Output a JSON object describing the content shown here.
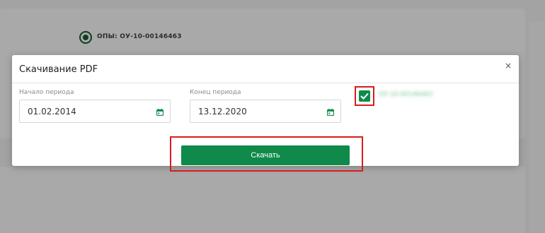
{
  "background": {
    "radio_label": "ОПЫ: ОУ-10-00146463"
  },
  "modal": {
    "title": "Скачивание PDF",
    "close_symbol": "×",
    "start": {
      "label": "Начало периода",
      "value": "01.02.2014",
      "icon": "calendar-icon"
    },
    "end": {
      "label": "Конец периода",
      "value": "13.12.2020",
      "icon": "calendar-icon"
    },
    "checkbox": {
      "checked": true,
      "label": "ОУ-10-00146463"
    },
    "download_label": "Скачать"
  },
  "colors": {
    "brand_green": "#0f8a4a",
    "highlight_red": "#d81d1d",
    "overlay": "#a3a3a3"
  }
}
